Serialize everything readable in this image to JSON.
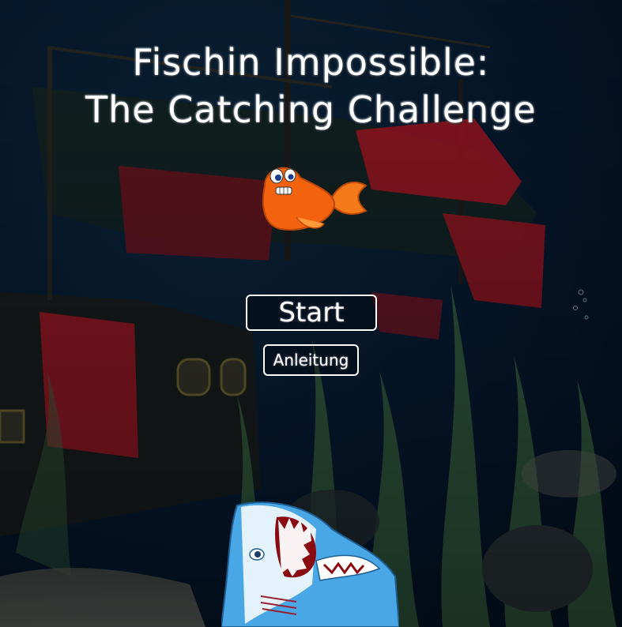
{
  "game": {
    "title_line1": "Fischin Impossible:",
    "title_line2": "The Catching Challenge",
    "menu": {
      "start_label": "Start",
      "instructions_label": "Anleitung"
    }
  },
  "sprites": {
    "player_fish": "orange-fish-icon",
    "enemy_shark": "shark-icon"
  },
  "colors": {
    "background": "#03101f",
    "sail_red": "#b3141c",
    "fish_orange": "#f2620f",
    "shark_blue": "#4aa7e6",
    "seaweed_green": "#3f6a3a"
  }
}
